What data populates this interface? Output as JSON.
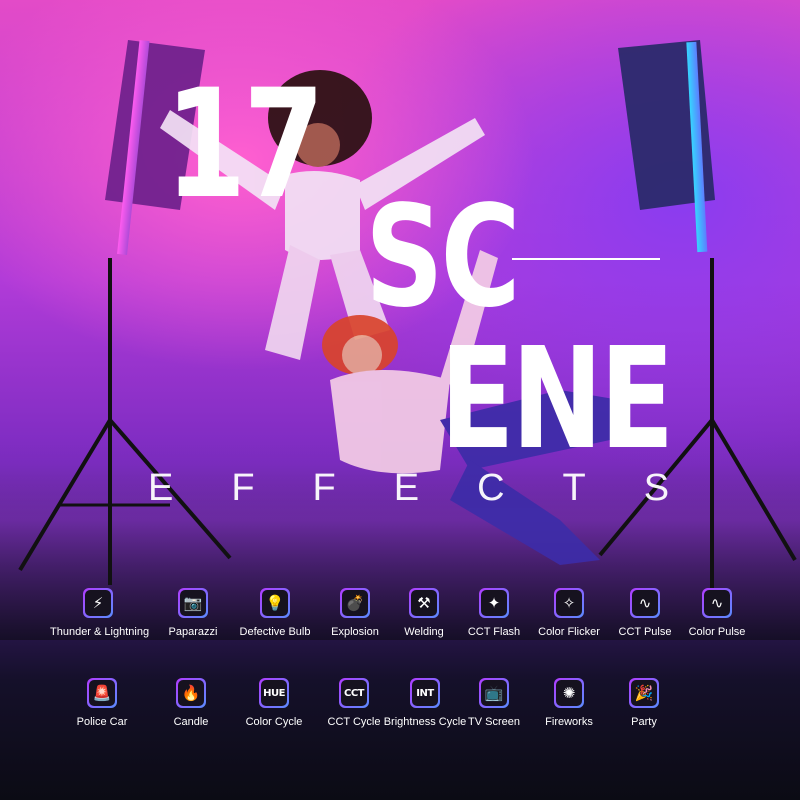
{
  "headline": {
    "number": "17",
    "word_top": "SC",
    "word_bottom": "ENE",
    "subtitle": "EFFECTS"
  },
  "scenes_row1": [
    {
      "label": "Thunder & Lightning",
      "icon": "lightning-icon",
      "glyph": "⚡"
    },
    {
      "label": "Paparazzi",
      "icon": "camera-flash-icon",
      "glyph": "📷"
    },
    {
      "label": "Defective Bulb",
      "icon": "bulb-icon",
      "glyph": "💡"
    },
    {
      "label": "Explosion",
      "icon": "bomb-icon",
      "glyph": "💣"
    },
    {
      "label": "Welding",
      "icon": "welding-icon",
      "glyph": "⚒"
    },
    {
      "label": "CCT Flash",
      "icon": "flash-circle-icon",
      "glyph": "✦"
    },
    {
      "label": "Color Flicker",
      "icon": "flicker-circle-icon",
      "glyph": "✧"
    },
    {
      "label": "CCT Pulse",
      "icon": "pulse-circle-icon",
      "glyph": "∿"
    },
    {
      "label": "Color Pulse",
      "icon": "color-pulse-circle-icon",
      "glyph": "∿"
    }
  ],
  "scenes_row2": [
    {
      "label": "Police Car",
      "icon": "siren-icon",
      "glyph": "🚨"
    },
    {
      "label": "Candle",
      "icon": "flame-icon",
      "glyph": "🔥"
    },
    {
      "label": "Color Cycle",
      "icon": "hue-icon",
      "glyph": "HUE"
    },
    {
      "label": "CCT Cycle",
      "icon": "cct-icon",
      "glyph": "CCT"
    },
    {
      "label": "Brightness Cycle",
      "icon": "int-icon",
      "glyph": "INT"
    },
    {
      "label": "TV Screen",
      "icon": "tv-icon",
      "glyph": "📺"
    },
    {
      "label": "Fireworks",
      "icon": "fireworks-icon",
      "glyph": "✺"
    },
    {
      "label": "Party",
      "icon": "party-icon",
      "glyph": "🎉"
    }
  ],
  "colors": {
    "background_top": "#e34bc8",
    "background_mid": "#7a2bc0",
    "background_bottom": "#0b0b14",
    "icon_border_start": "#b13cff",
    "icon_border_end": "#5a8cff",
    "left_light": "#ff5cf0",
    "right_light": "#36d6ff"
  }
}
